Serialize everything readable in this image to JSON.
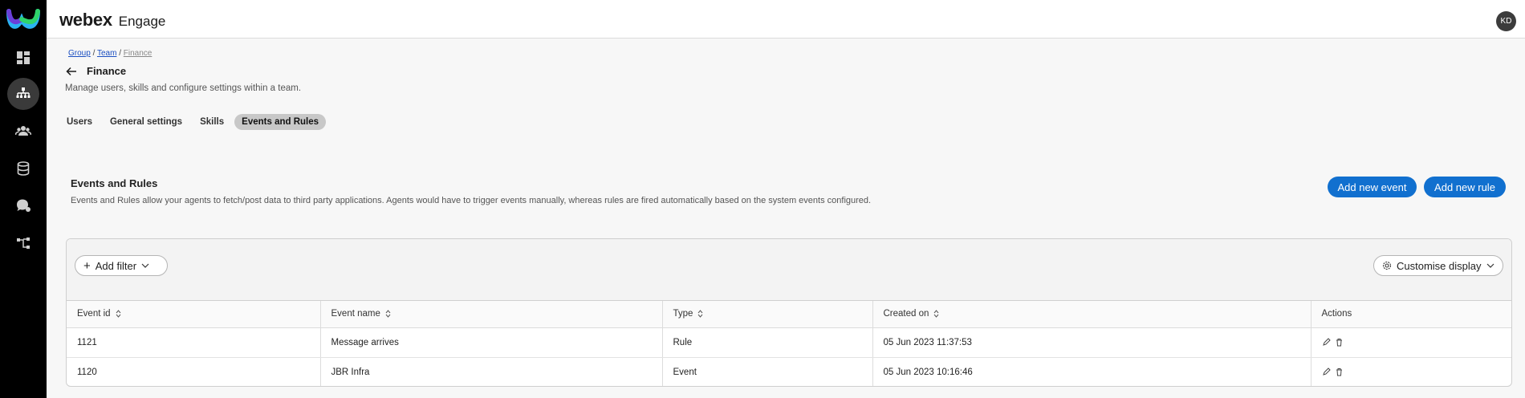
{
  "app": {
    "brand": "webex",
    "product": "Engage",
    "avatar_initials": "KD"
  },
  "rail": {
    "items": [
      {
        "name": "dashboard",
        "icon": "dashboard-icon",
        "active": false
      },
      {
        "name": "teams",
        "icon": "org-chart-icon",
        "active": true
      },
      {
        "name": "users",
        "icon": "users-icon",
        "active": false
      },
      {
        "name": "database",
        "icon": "database-icon",
        "active": false
      },
      {
        "name": "chat",
        "icon": "chat-bubbles-icon",
        "active": false
      },
      {
        "name": "flows",
        "icon": "flow-icon",
        "active": false
      }
    ]
  },
  "breadcrumb": {
    "group": "Group",
    "team": "Team",
    "current": "Finance"
  },
  "page": {
    "title": "Finance",
    "description": "Manage users, skills and configure settings within a team."
  },
  "tabs": [
    {
      "label": "Users",
      "active": false
    },
    {
      "label": "General settings",
      "active": false
    },
    {
      "label": "Skills",
      "active": false
    },
    {
      "label": "Events and Rules",
      "active": true
    }
  ],
  "section": {
    "title": "Events and Rules",
    "description": "Events and Rules allow your agents to fetch/post data to third party applications. Agents would have to trigger events manually, whereas rules are fired automatically based on the system events configured."
  },
  "actions": {
    "add_event": "Add new event",
    "add_rule": "Add new rule"
  },
  "toolbar": {
    "add_filter": "Add filter",
    "customise": "Customise display"
  },
  "table": {
    "columns": [
      "Event id",
      "Event name",
      "Type",
      "Created on",
      "Actions"
    ],
    "rows": [
      {
        "id": "1121",
        "name": "Message arrives",
        "type": "Rule",
        "created": "05 Jun 2023 11:37:53"
      },
      {
        "id": "1120",
        "name": "JBR Infra",
        "type": "Event",
        "created": "05 Jun 2023 10:16:46"
      }
    ]
  },
  "colors": {
    "accent": "#1170cf",
    "rail": "#000000",
    "active_tab": "#c8c8c8"
  }
}
